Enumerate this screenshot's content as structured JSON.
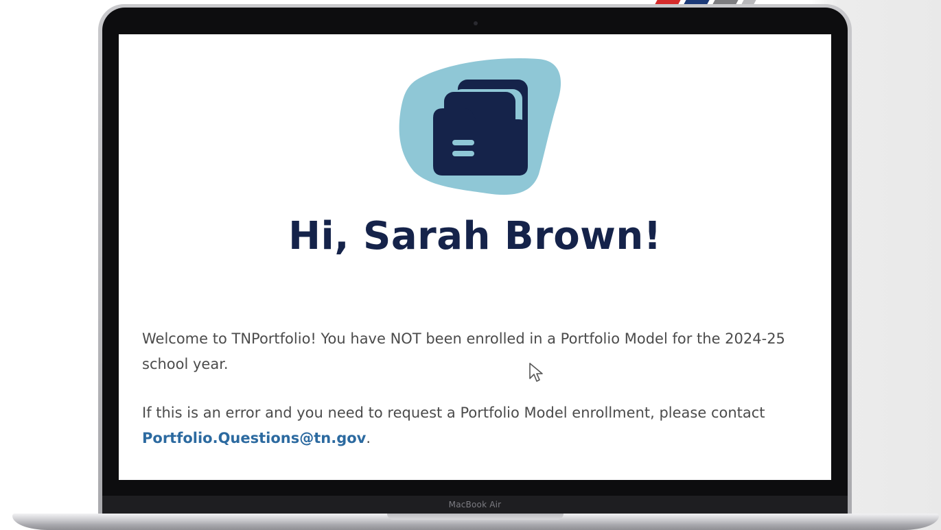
{
  "colors": {
    "stripe_red": "#d52b2b",
    "stripe_navy": "#1c3a78",
    "stripe_gray": "#7d7d80",
    "heading_navy": "#15234a",
    "body_text": "#4b4b4b",
    "link_blue": "#2c6aa0",
    "icon_blob": "#8fc7d6",
    "icon_folder": "#15234a"
  },
  "laptop": {
    "label": "MacBook Air"
  },
  "screen": {
    "hero_icon": "folder-icon",
    "greeting": "Hi, Sarah Brown!",
    "message_1": "Welcome to TNPortfolio! You have NOT been enrolled in a Portfolio Model for the 2024-25 school year.",
    "message_2_prefix": "If this is an error and you need to request a Portfolio Model enrollment, please contact ",
    "contact_email": "Portfolio.Questions@tn.gov",
    "message_2_suffix": "."
  }
}
